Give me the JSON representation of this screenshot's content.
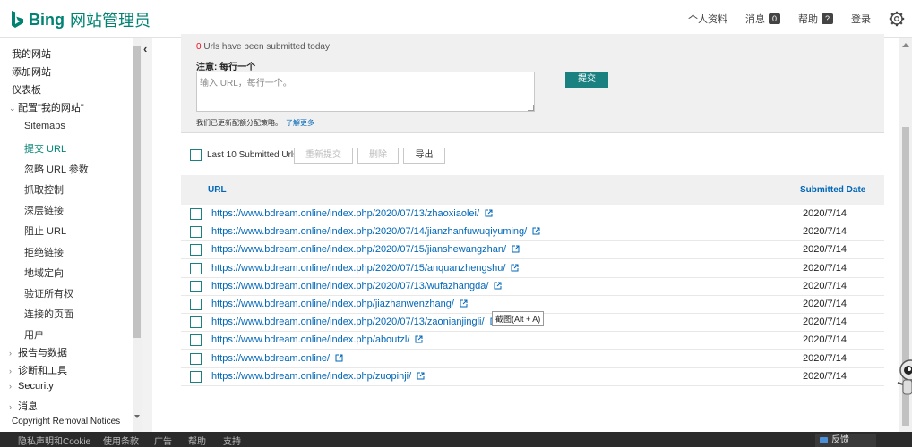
{
  "header": {
    "brand": "Bing",
    "title": "网站管理员",
    "nav": {
      "profile": "个人资料",
      "messages": "消息",
      "messages_count": "0",
      "help": "帮助",
      "help_badge": "?",
      "login": "登录"
    }
  },
  "sidebar": {
    "my_sites": "我的网站",
    "add_site": "添加网站",
    "dashboard": "仪表板",
    "configure": "配置\"我的网站\"",
    "sub_items": [
      "Sitemaps",
      "提交 URL",
      "忽略 URL 参数",
      "抓取控制",
      "深层链接",
      "阻止 URL",
      "拒绝链接",
      "地域定向",
      "验证所有权",
      "连接的页面",
      "用户"
    ],
    "reports": "报告与数据",
    "diagnostics": "诊断和工具",
    "security": "Security",
    "messages": "消息",
    "copyright": "Copyright Removal Notices"
  },
  "submit": {
    "count": "0",
    "status_text": " Urls have been submitted today",
    "note_label": "注意: 每行一个",
    "placeholder": "输入 URL，每行一个。",
    "submit_button": "提交",
    "quota_note": "我们已更新配额分配策略。",
    "learn_more": "了解更多"
  },
  "toolbar": {
    "label": "Last 10 Submitted Urls",
    "resubmit": "重新提交",
    "delete": "删除",
    "export": "导出"
  },
  "table": {
    "col_url": "URL",
    "col_date": "Submitted Date",
    "rows": [
      {
        "url": "https://www.bdream.online/index.php/2020/07/13/zhaoxiaolei/",
        "date": "2020/7/14"
      },
      {
        "url": "https://www.bdream.online/index.php/2020/07/14/jianzhanfuwuqiyuming/",
        "date": "2020/7/14"
      },
      {
        "url": "https://www.bdream.online/index.php/2020/07/15/jianshewangzhan/",
        "date": "2020/7/14"
      },
      {
        "url": "https://www.bdream.online/index.php/2020/07/15/anquanzhengshu/",
        "date": "2020/7/14"
      },
      {
        "url": "https://www.bdream.online/index.php/2020/07/13/wufazhangda/",
        "date": "2020/7/14"
      },
      {
        "url": "https://www.bdream.online/index.php/jiazhanwenzhang/",
        "date": "2020/7/14"
      },
      {
        "url": "https://www.bdream.online/index.php/2020/07/13/zaonianjingli/",
        "date": "2020/7/14"
      },
      {
        "url": "https://www.bdream.online/index.php/aboutzl/",
        "date": "2020/7/14"
      },
      {
        "url": "https://www.bdream.online/",
        "date": "2020/7/14"
      },
      {
        "url": "https://www.bdream.online/index.php/zuopinji/",
        "date": "2020/7/14"
      }
    ]
  },
  "tooltip": "截图(Alt + A)",
  "footer": {
    "privacy": "隐私声明和Cookie",
    "terms": "使用条款",
    "ads": "广告",
    "help": "帮助",
    "support": "支持",
    "feedback": "反馈"
  },
  "colors": {
    "brand": "#008373",
    "accent": "#1b8080",
    "link": "#0067b8",
    "count": "#e81123"
  }
}
